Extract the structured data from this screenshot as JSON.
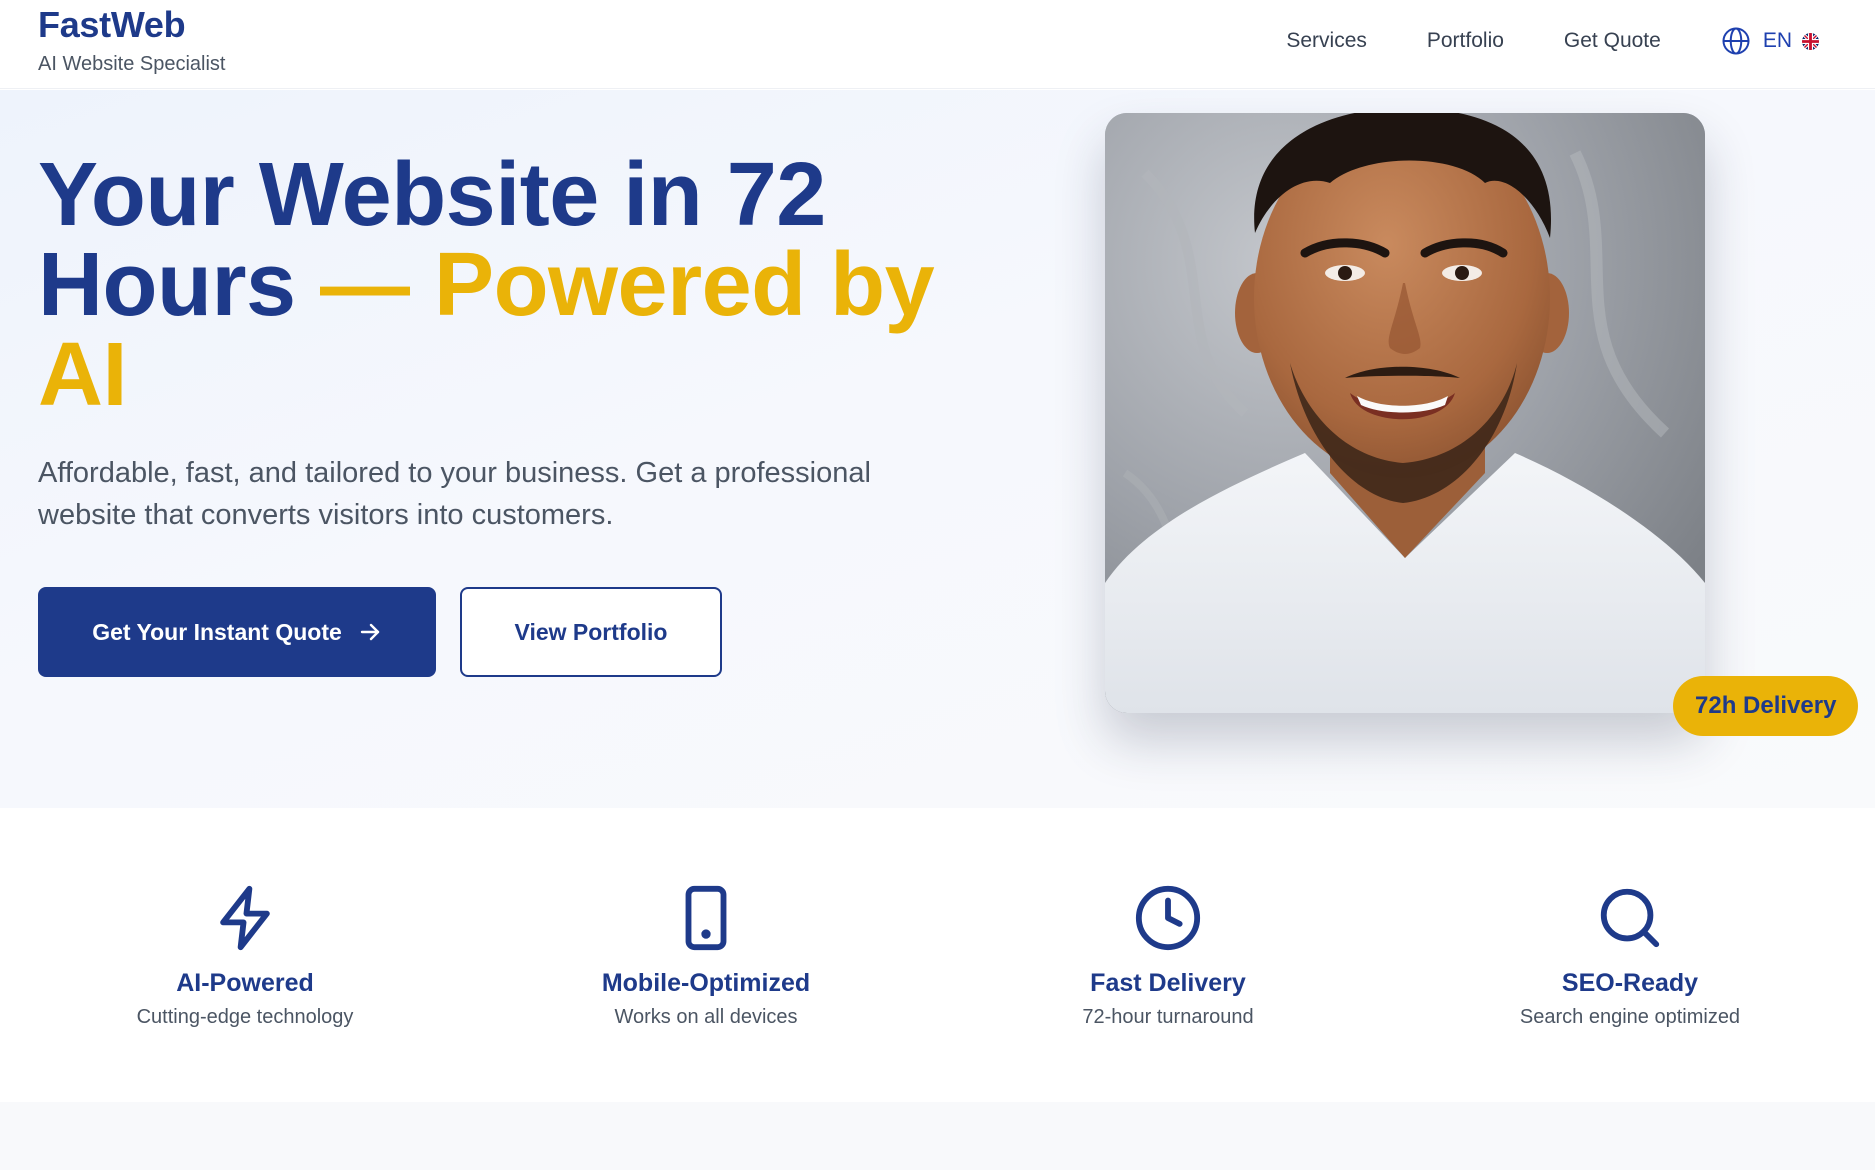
{
  "header": {
    "brand_name": "FastWeb",
    "brand_tagline": "AI Website Specialist",
    "nav": [
      "Services",
      "Portfolio",
      "Get Quote"
    ],
    "language": {
      "code": "EN",
      "icon": "globe-icon",
      "flag": "uk-flag-icon"
    }
  },
  "hero": {
    "title_part1": "Your Website in 72 Hours ",
    "title_accent": "— Powered by AI",
    "subtitle": "Affordable, fast, and tailored to your business. Get a professional website that converts visitors into customers.",
    "primary_button": "Get Your Instant Quote",
    "primary_button_icon": "arrow-right-icon",
    "secondary_button": "View Portfolio",
    "badge": "72h Delivery"
  },
  "features": [
    {
      "icon": "lightning-bolt-icon",
      "title": "AI-Powered",
      "desc": "Cutting-edge technology"
    },
    {
      "icon": "smartphone-icon",
      "title": "Mobile-Optimized",
      "desc": "Works on all devices"
    },
    {
      "icon": "clock-icon",
      "title": "Fast Delivery",
      "desc": "72-hour turnaround"
    },
    {
      "icon": "search-icon",
      "title": "SEO-Ready",
      "desc": "Search engine optimized"
    }
  ],
  "colors": {
    "primary": "#1e3a8a",
    "accent": "#eab308",
    "text_muted": "#4b5563"
  }
}
